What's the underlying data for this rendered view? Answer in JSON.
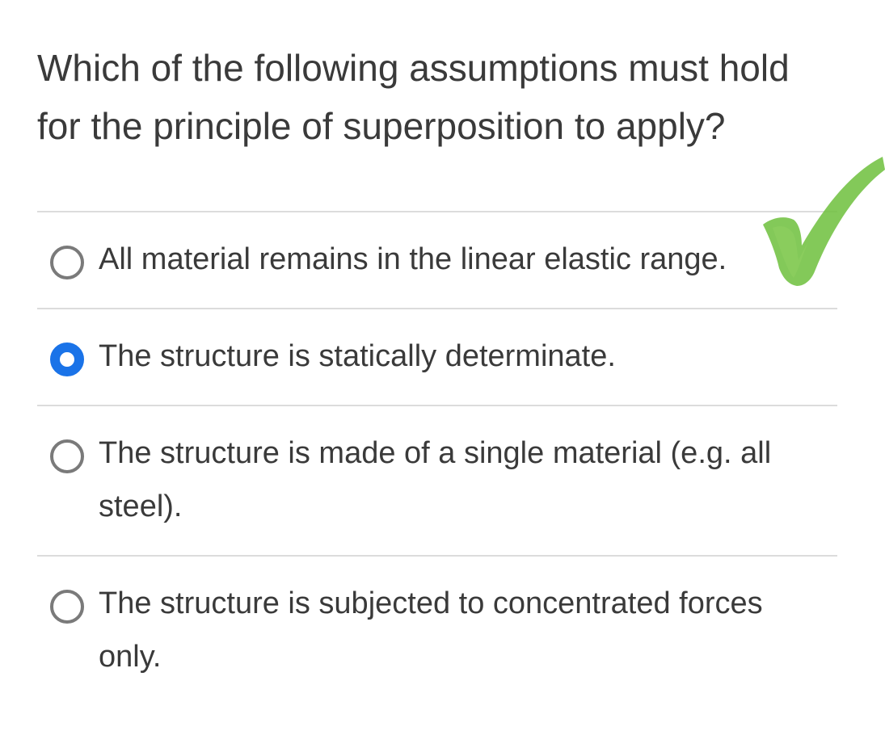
{
  "question": {
    "text": "Which of the following assumptions must hold for the principle of superposition to apply?"
  },
  "options": [
    {
      "label": "All material remains in the linear elastic range.",
      "selected": false
    },
    {
      "label": "The structure is statically determinate.",
      "selected": true
    },
    {
      "label": "The structure is made of a single material (e.g. all steel).",
      "selected": false
    },
    {
      "label": "The structure is subjected to concentrated forces only.",
      "selected": false
    }
  ],
  "colors": {
    "selected_radio": "#1a73e8",
    "unselected_radio": "#7a7a7a",
    "checkmark": "#6dbf3c",
    "divider": "#dcdcdc",
    "text": "#3a3a3a"
  },
  "annotation": {
    "icon": "green-checkmark-icon"
  }
}
